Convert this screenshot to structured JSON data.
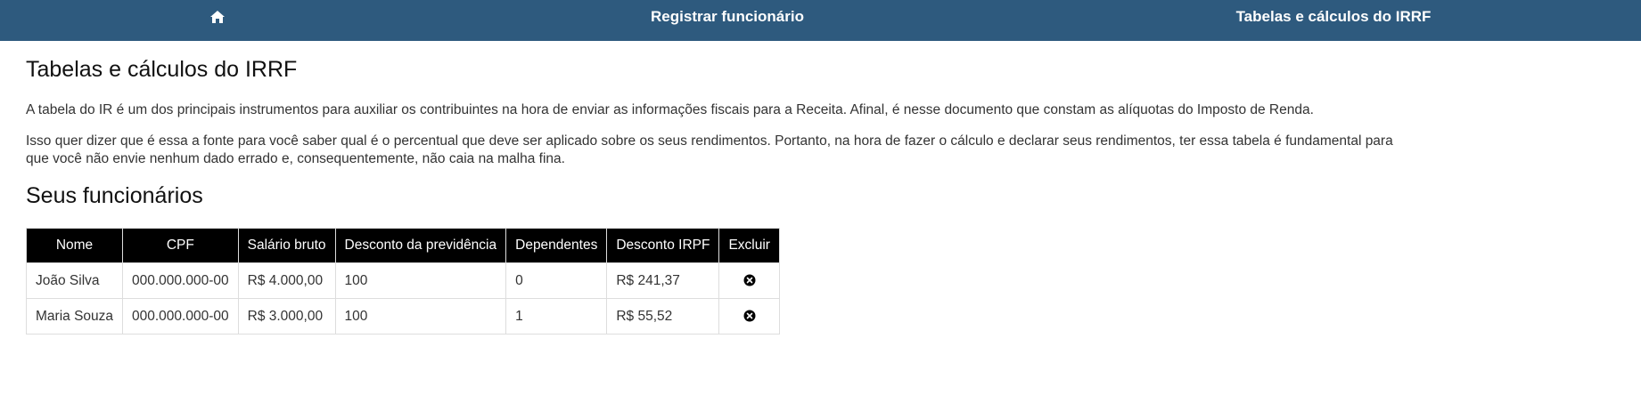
{
  "nav": {
    "home_icon": "home-icon",
    "register_label": "Registrar funcionário",
    "tables_label": "Tabelas e cálculos do IRRF"
  },
  "main": {
    "title": "Tabelas e cálculos do IRRF",
    "paragraphs": [
      "A tabela do IR é um dos principais instrumentos para auxiliar os contribuintes na hora de enviar as informações fiscais para a Receita. Afinal, é nesse documento que constam as alíquotas do Imposto de Renda.",
      "Isso quer dizer que é essa a fonte para você saber qual é o percentual que deve ser aplicado sobre os seus rendimentos. Portanto, na hora de fazer o cálculo e declarar seus rendimentos, ter essa tabela é fundamental para que você não envie nenhum dado errado e, consequentemente, não caia na malha fina."
    ],
    "section_title": "Seus funcionários"
  },
  "table": {
    "headers": [
      "Nome",
      "CPF",
      "Salário bruto",
      "Desconto da previdência",
      "Dependentes",
      "Desconto IRPF",
      "Excluir"
    ],
    "rows": [
      [
        "João Silva",
        "000.000.000-00",
        "R$ 4.000,00",
        "100",
        "0",
        "R$ 241,37"
      ],
      [
        "Maria Souza",
        "000.000.000-00",
        "R$ 3.000,00",
        "100",
        "1",
        "R$ 55,52"
      ]
    ],
    "delete_icon": "close-circle-icon"
  },
  "colors": {
    "nav_bg": "#2e5a7e",
    "header_bg": "#000000"
  }
}
